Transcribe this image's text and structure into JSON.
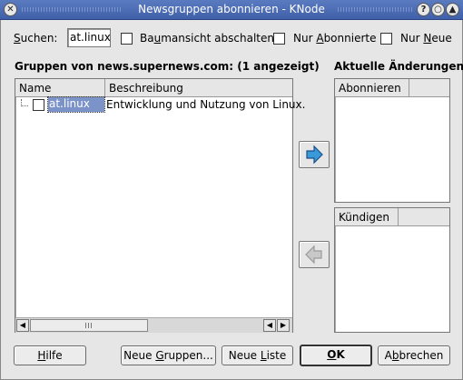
{
  "window": {
    "title": "Newsgruppen abonnieren - KNode"
  },
  "search": {
    "label_prefix": "",
    "label_underlined": "S",
    "label_rest": "uchen:",
    "value": "at.linux"
  },
  "options": {
    "tree": {
      "prefix": "Ba",
      "underlined": "u",
      "rest": "mansicht abschalten",
      "checked": false
    },
    "subscribed": {
      "prefix": "Nur ",
      "underlined": "A",
      "rest": "bonnierte",
      "checked": false
    },
    "new": {
      "prefix": "Nur ",
      "underlined": "N",
      "rest": "eue",
      "checked": false
    }
  },
  "groups": {
    "heading": "Gruppen von news.supernews.com: (1 angezeigt)",
    "col_name": "Name",
    "col_desc": "Beschreibung",
    "rows": [
      {
        "name": "at.linux",
        "description": "Entwicklung und Nutzung von Linux.",
        "checked": false,
        "selected": true
      }
    ]
  },
  "changes": {
    "heading": "Aktuelle Änderungen:",
    "subscribe_header": "Abonnieren",
    "unsubscribe_header": "Kündigen"
  },
  "buttons": {
    "help": {
      "prefix": "",
      "underlined": "H",
      "rest": "ilfe"
    },
    "new_groups": {
      "prefix": "Neue ",
      "underlined": "G",
      "rest": "ruppen..."
    },
    "new_list": {
      "prefix": "Neue ",
      "underlined": "L",
      "rest": "iste"
    },
    "ok": {
      "prefix": "",
      "underlined": "O",
      "rest": "K"
    },
    "cancel": {
      "prefix": "A",
      "underlined": "b",
      "rest": "brechen"
    }
  },
  "colors": {
    "titlebar": "#4a6bb5",
    "selection": "#7b93c9",
    "arrow_active": "#3a9ad9"
  },
  "icons": {
    "close": "close-icon",
    "help": "help-icon",
    "minimize": "minimize-icon",
    "maximize": "maximize-icon",
    "add": "arrow-right-icon",
    "remove": "arrow-left-icon"
  }
}
